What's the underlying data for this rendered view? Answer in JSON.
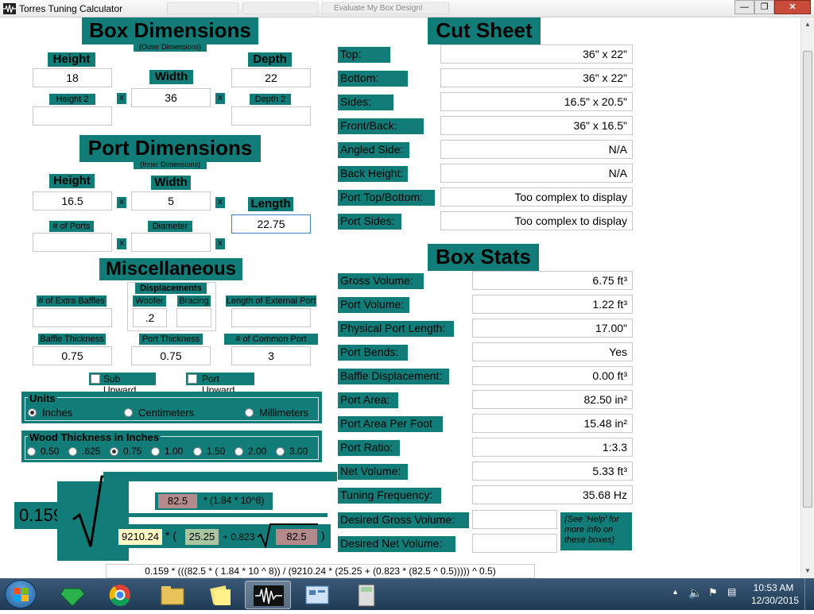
{
  "window": {
    "title": "Torres Tuning Calculator",
    "bg_tabs": [
      "",
      "",
      "",
      "Evaluate My Box Design!"
    ]
  },
  "box": {
    "title": "Box Dimensions",
    "subtitle": "(Outer Dimensions)",
    "height_label": "Height",
    "height": "18",
    "width_label": "Width",
    "width": "36",
    "depth_label": "Depth",
    "depth": "22",
    "height2_label": "Height 2",
    "height2": "",
    "depth2_label": "Depth 2",
    "depth2": "",
    "x": "x"
  },
  "port": {
    "title": "Port Dimensions",
    "subtitle": "(Inner Dimensions)",
    "height_label": "Height",
    "height": "16.5",
    "width_label": "Width",
    "width": "5",
    "length_label": "Length",
    "length": "22.75",
    "ports_label": "# of Ports",
    "ports": "",
    "diameter_label": "Diameter",
    "diameter": ""
  },
  "misc": {
    "title": "Miscellaneous",
    "displacements_label": "Displacements",
    "extra_baffles_label": "# of Extra Baffles",
    "extra_baffles": "",
    "woofer_label": "Woofer",
    "woofer": ".2",
    "bracing_label": "Bracing",
    "bracing": "",
    "ext_port_label": "Length of External Port",
    "ext_port": "",
    "baffle_thickness_label": "Baffle Thickness",
    "baffle_thickness": "0.75",
    "port_thickness_label": "Port Thickness",
    "port_thickness": "0.75",
    "common_walls_label": "# of Common Port Walls",
    "common_walls": "3",
    "sub_upward_label": "Sub Upward",
    "port_upward_label": "Port Upward"
  },
  "units": {
    "title": "Units",
    "options": [
      "Inches",
      "Centimeters",
      "Millimeters"
    ],
    "selected": "Inches"
  },
  "wood": {
    "title": "Wood Thickness in Inches",
    "options": [
      "0.50",
      ".625",
      "0.75",
      "1.00",
      "1.50",
      "2.00",
      "3.00"
    ],
    "selected": "0.75"
  },
  "formula": {
    "constant": "0.159",
    "port_area": "82.5",
    "numerator_tail": "* (1.84 * 10^8)",
    "net_volume": "9210.24",
    "times_open": "* (",
    "length": "25.25",
    "plus": "+ 0.823",
    "sqrt_area": "82.5",
    "close": ")",
    "expression": "0.159 * (((82.5 * ( 1.84 * 10 ^ 8)) / (9210.24 * (25.25 + (0.823 * (82.5 ^ 0.5))))) ^ 0.5)"
  },
  "cut": {
    "title": "Cut Sheet",
    "rows": [
      {
        "label": "Top:",
        "value": "36\" x 22\""
      },
      {
        "label": "Bottom:",
        "value": "36\" x 22\""
      },
      {
        "label": "Sides:",
        "value": "16.5\" x 20.5\""
      },
      {
        "label": "Front/Back:",
        "value": "36\" x 16.5\""
      },
      {
        "label": "Angled Side:",
        "value": "N/A"
      },
      {
        "label": "Back Height:",
        "value": "N/A"
      },
      {
        "label": "Port Top/Bottom:",
        "value": "Too complex to display"
      },
      {
        "label": "Port Sides:",
        "value": "Too complex to display"
      }
    ]
  },
  "stats": {
    "title": "Box Stats",
    "rows": [
      {
        "label": "Gross Volume:",
        "value": "6.75 ft³"
      },
      {
        "label": "Port Volume:",
        "value": "1.22 ft³"
      },
      {
        "label": "Physical Port Length:",
        "value": "17.00\""
      },
      {
        "label": "Port Bends:",
        "value": "Yes"
      },
      {
        "label": "Baffle Displacement:",
        "value": "0.00 ft³"
      },
      {
        "label": "Port Area:",
        "value": "82.50 in²"
      },
      {
        "label": "Port Area Per Foot",
        "value": "15.48 in²"
      },
      {
        "label": "Port Ratio:",
        "value": "1:3.3"
      },
      {
        "label": "Net Volume:",
        "value": "5.33 ft³"
      },
      {
        "label": "Tuning Frequency:",
        "value": "35.68 Hz"
      },
      {
        "label": "Desired Gross Volume:",
        "value": ""
      },
      {
        "label": "Desired Net Volume:",
        "value": ""
      }
    ],
    "help_note": "(See 'Help' for more info on these boxes)"
  },
  "taskbar": {
    "time": "10:53 AM",
    "date": "12/30/2015"
  },
  "colors": {
    "teal": "#117c78",
    "formula_red": "#b48b8a",
    "formula_yellow": "#fdf7c4",
    "formula_green": "#a9c6a0"
  }
}
